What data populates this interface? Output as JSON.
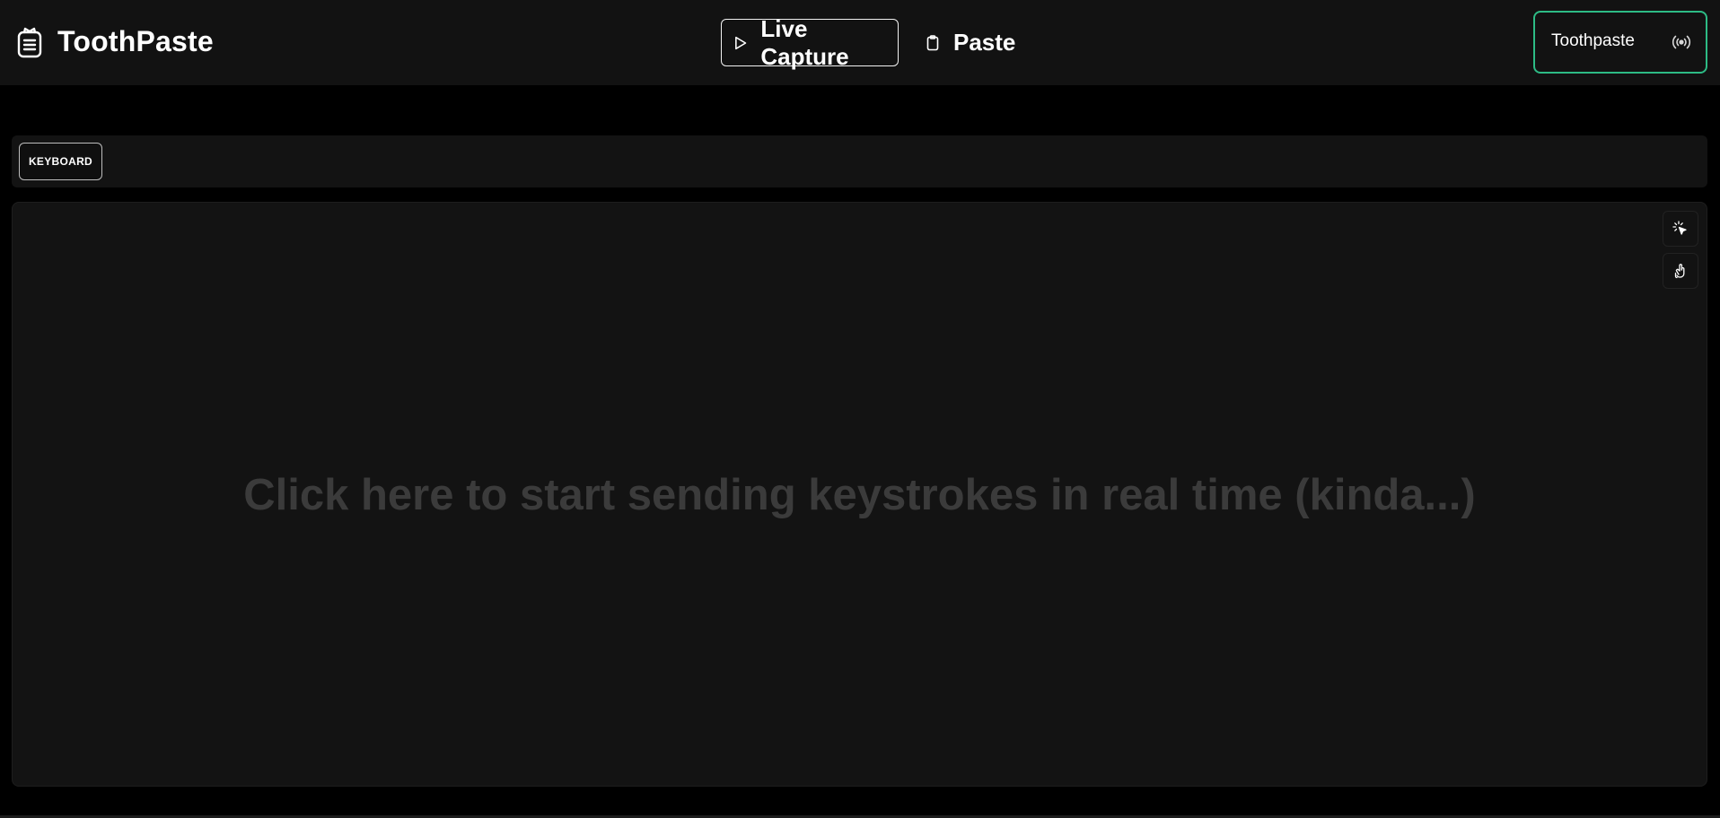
{
  "header": {
    "title": "ToothPaste",
    "logo_icon": "clipboard-list-icon",
    "nav": [
      {
        "label": "Live Capture",
        "icon": "play-icon",
        "active": true
      },
      {
        "label": "Paste",
        "icon": "clipboard-icon",
        "active": false
      }
    ],
    "device": {
      "name": "Toothpaste",
      "icon": "broadcast-icon",
      "status_color": "#2dbb85"
    }
  },
  "toolbar": {
    "keyboard_label": "KEYBOARD"
  },
  "capture": {
    "prompt": "Click here to start sending keystrokes in real time (kinda...)",
    "side_buttons": [
      {
        "icon": "click-pointer-icon"
      },
      {
        "icon": "hand-tap-icon"
      }
    ]
  },
  "colors": {
    "background": "#000000",
    "panel": "#131313",
    "accent": "#2dbb85",
    "prompt_text": "#3b3b3b"
  }
}
